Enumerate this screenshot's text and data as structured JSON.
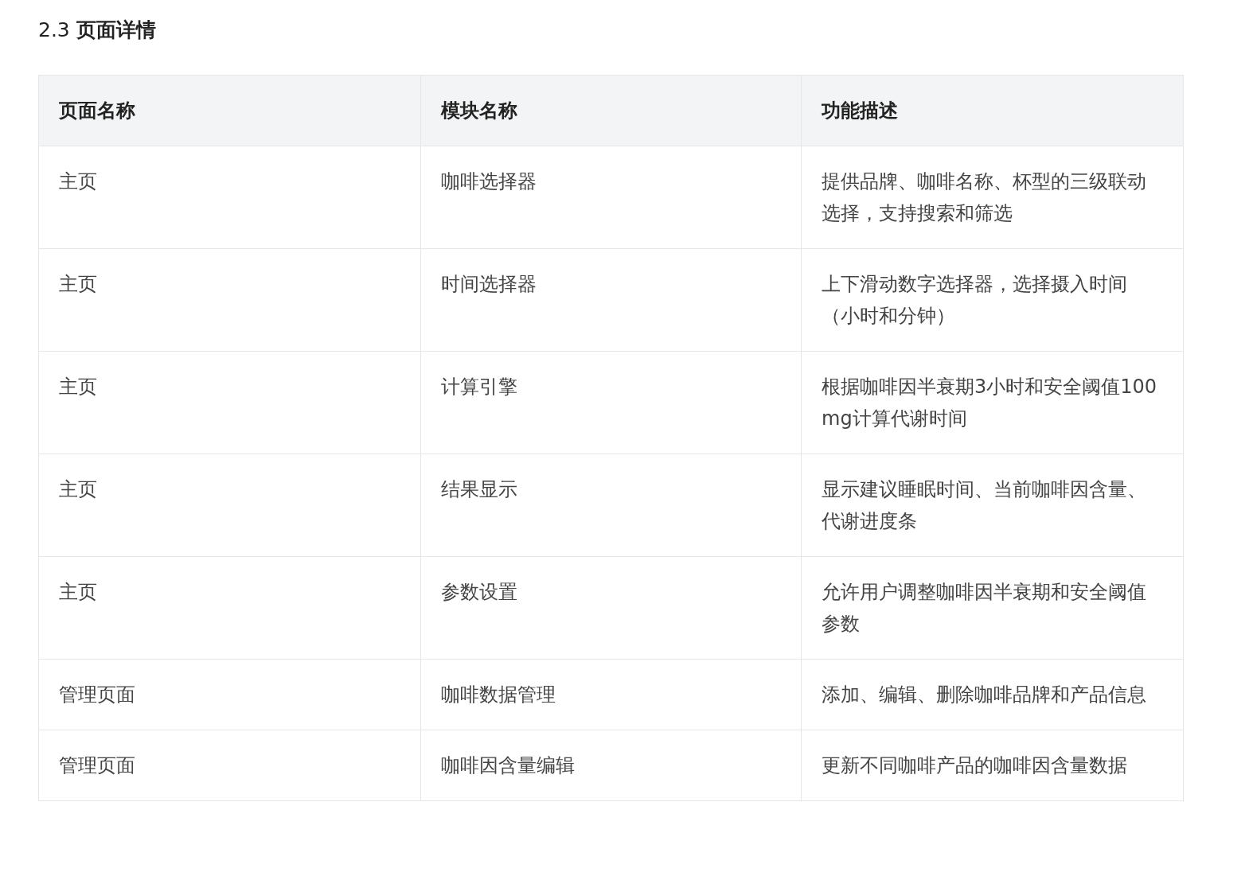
{
  "heading": "2.3 **页面详情**",
  "table": {
    "columns": [
      "页面名称",
      "模块名称",
      "功能描述"
    ],
    "rows": [
      [
        "主页",
        "咖啡选择器",
        "提供品牌、咖啡名称、杯型的三级联动选择，支持搜索和筛选"
      ],
      [
        "主页",
        "时间选择器",
        "上下滑动数字选择器，选择摄入时间（小时和分钟）"
      ],
      [
        "主页",
        "计算引擎",
        "根据咖啡因半衰期3小时和安全阈值100mg计算代谢时间"
      ],
      [
        "主页",
        "结果显示",
        "显示建议睡眠时间、当前咖啡因含量、代谢进度条"
      ],
      [
        "主页",
        "参数设置",
        "允许用户调整咖啡因半衰期和安全阈值参数"
      ],
      [
        "管理页面",
        "咖啡数据管理",
        "添加、编辑、删除咖啡品牌和产品信息"
      ],
      [
        "管理页面",
        "咖啡因含量编辑",
        "更新不同咖啡产品的咖啡因含量数据"
      ]
    ]
  }
}
